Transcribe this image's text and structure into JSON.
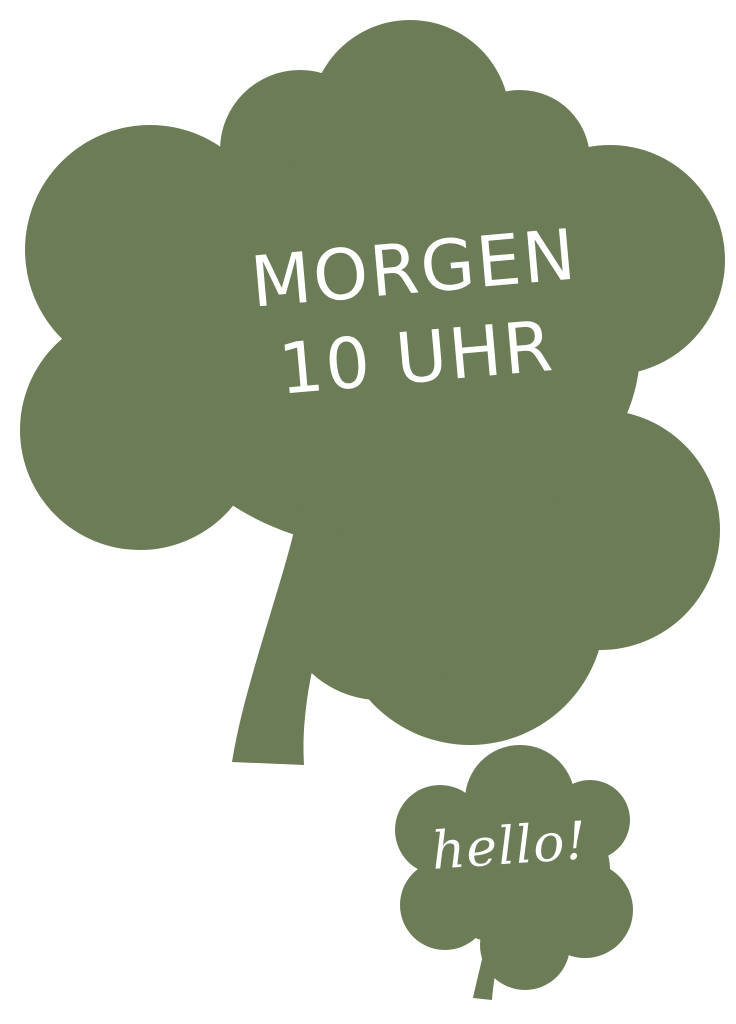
{
  "colors": {
    "clover": "#6b7c56",
    "ink": "#ffffff",
    "background": "#ffffff"
  },
  "big_clover": {
    "line1": "MORGEN",
    "line2": "10 UHR"
  },
  "small_clover": {
    "text": "hello!"
  }
}
